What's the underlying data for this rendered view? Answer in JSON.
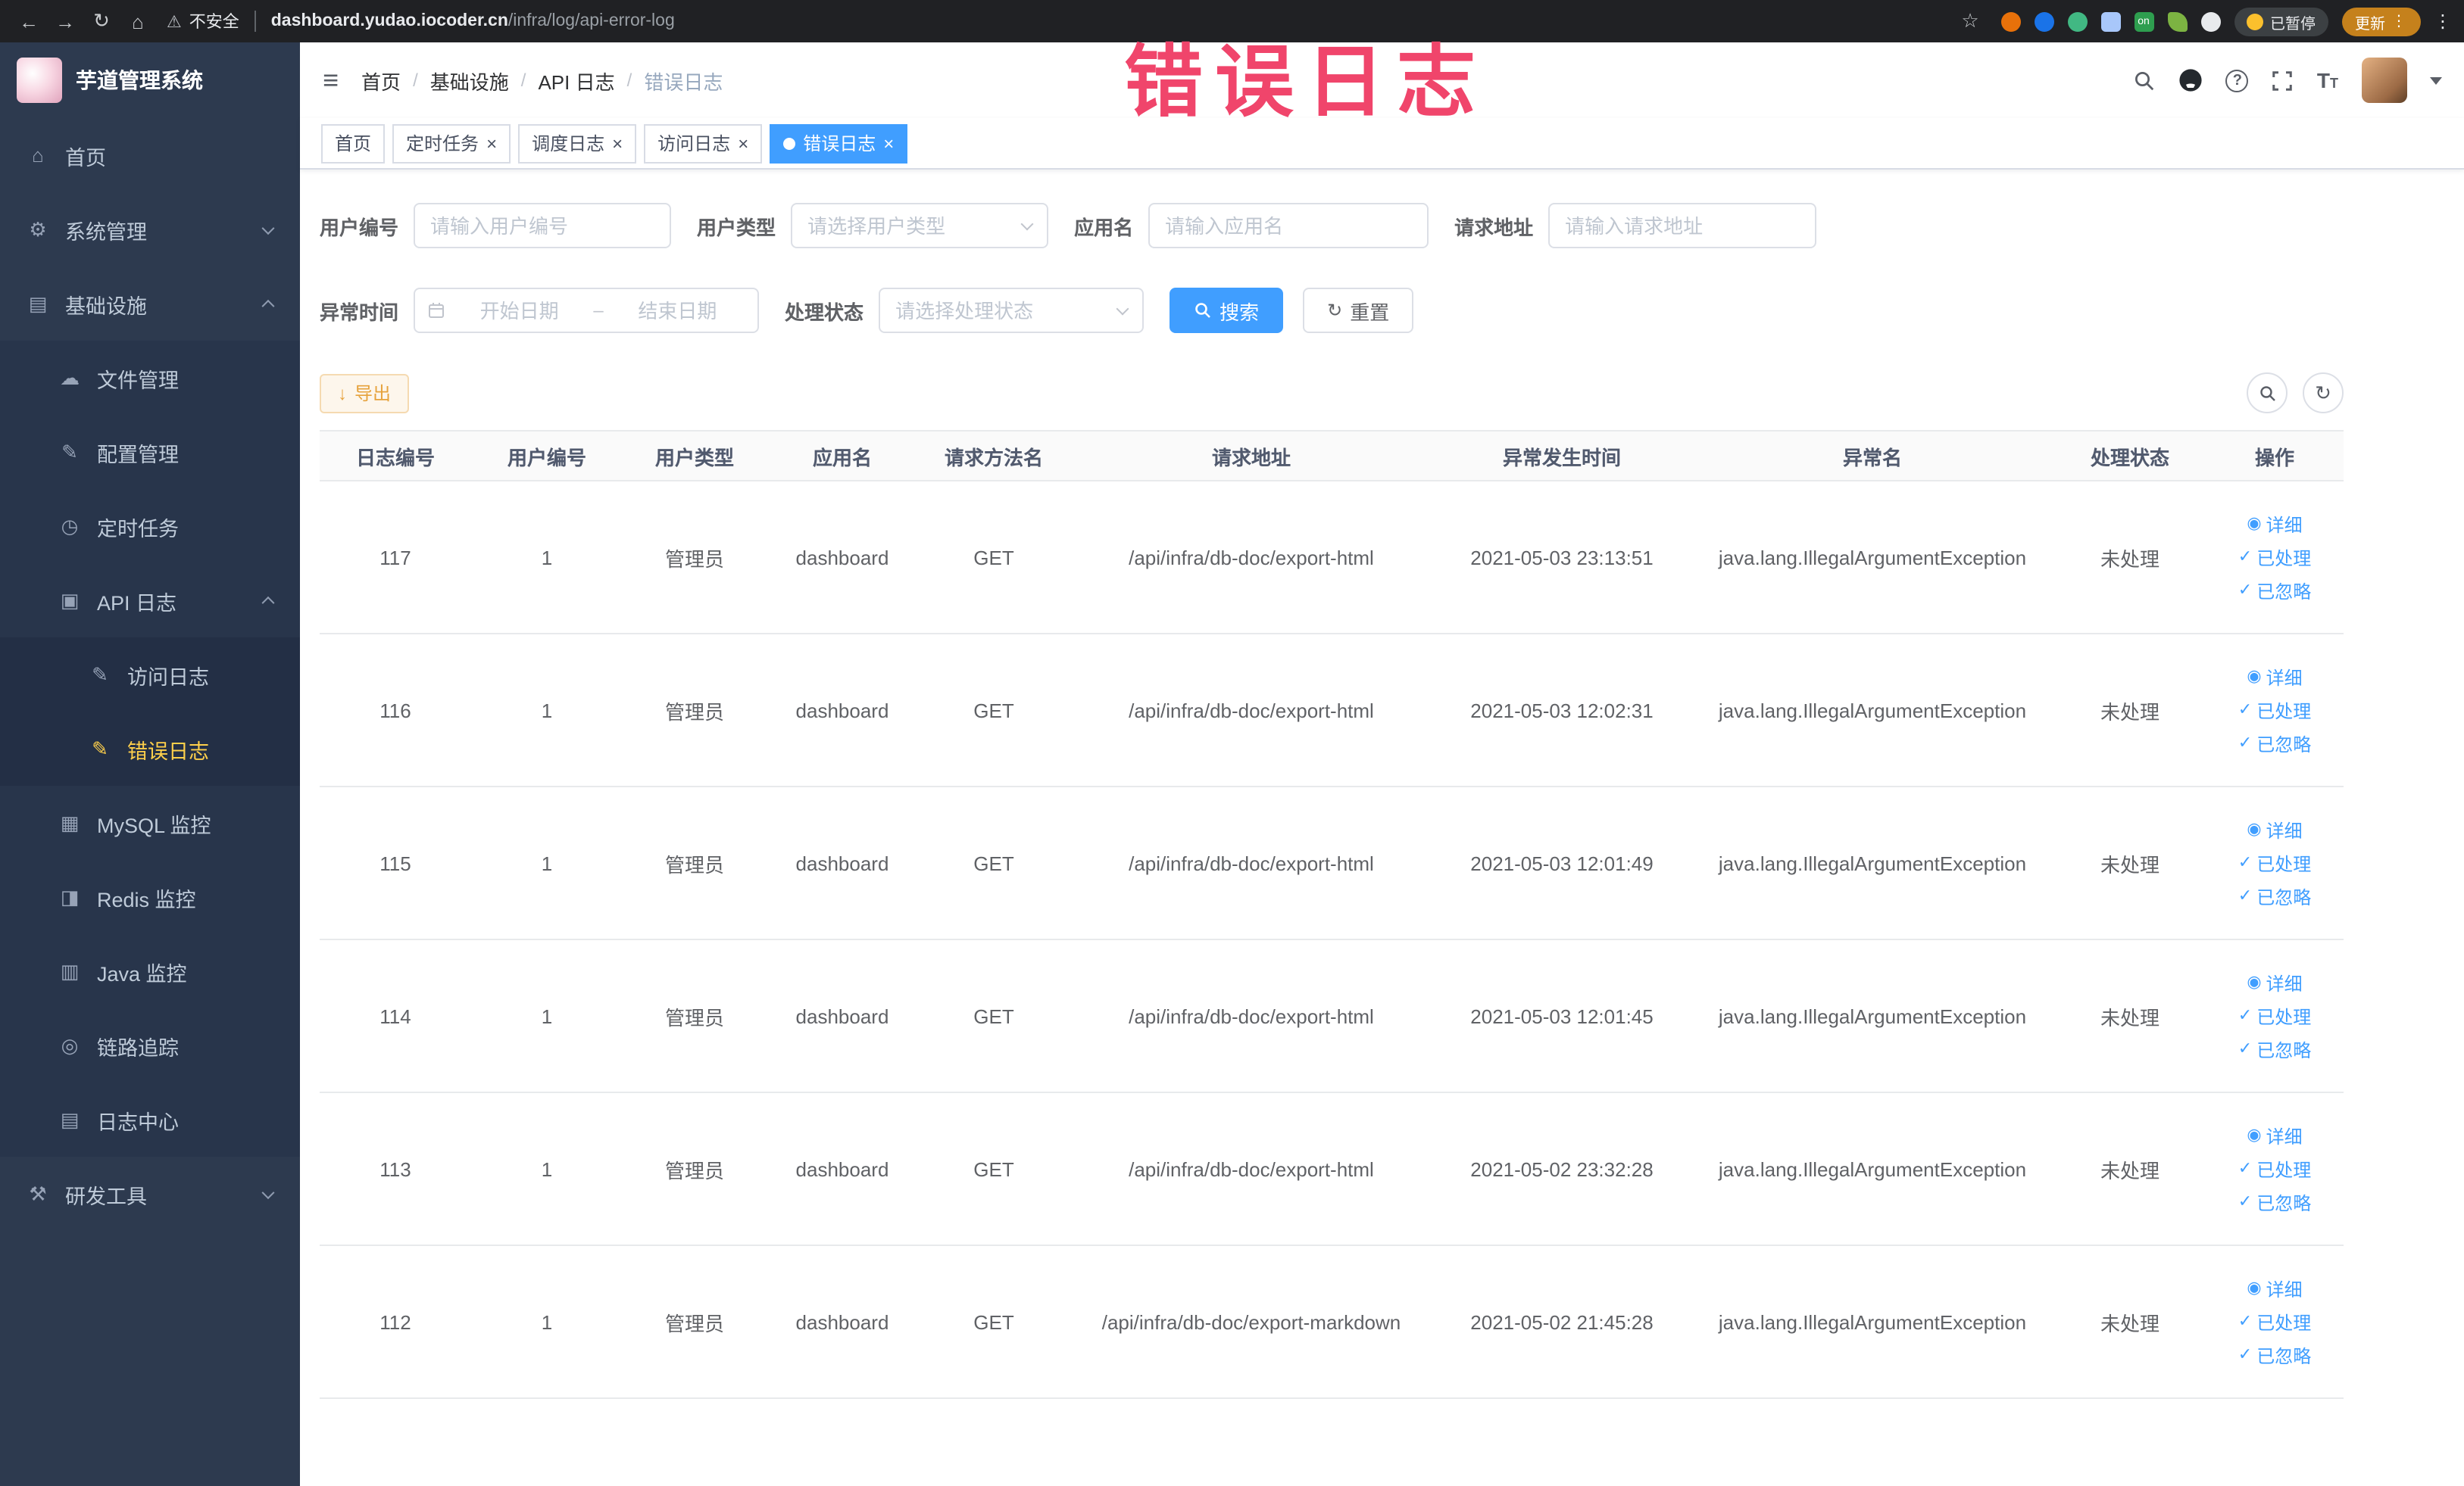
{
  "colors": {
    "primary_blue": "#409eff",
    "sidebar_background": "#2d3a4f",
    "sidebar_active_text": "#ffd04b",
    "annotation_pink": "#f0456b",
    "export_button_text": "#e6a23c",
    "update_button_background": "#c5811c"
  },
  "browser": {
    "security_warning": "不安全",
    "url_host": "dashboard.yudao.iocoder.cn",
    "url_path": "/infra/log/api-error-log",
    "extension_on_badge": "on",
    "paused_badge": "已暂停",
    "update_button": "更新"
  },
  "annotation": {
    "text": "错误日志"
  },
  "sidebar": {
    "logo_title": "芋道管理系统",
    "items": [
      {
        "label": "首页",
        "glyph": "⌂"
      },
      {
        "label": "系统管理",
        "glyph": "⚙"
      },
      {
        "label": "基础设施",
        "glyph": "▤"
      },
      {
        "label": "文件管理",
        "glyph": "☁"
      },
      {
        "label": "配置管理",
        "glyph": "✎"
      },
      {
        "label": "定时任务",
        "glyph": "◷"
      },
      {
        "label": "API 日志",
        "glyph": "▣"
      },
      {
        "label": "访问日志",
        "glyph": "✎"
      },
      {
        "label": "错误日志",
        "glyph": "✎"
      },
      {
        "label": "MySQL 监控",
        "glyph": "▦"
      },
      {
        "label": "Redis 监控",
        "glyph": "◨"
      },
      {
        "label": "Java 监控",
        "glyph": "▥"
      },
      {
        "label": "链路追踪",
        "glyph": "◎"
      },
      {
        "label": "日志中心",
        "glyph": "▤"
      },
      {
        "label": "研发工具",
        "glyph": "⚒"
      }
    ]
  },
  "header": {
    "breadcrumb": [
      "首页",
      "基础设施",
      "API 日志",
      "错误日志"
    ],
    "separator": "/"
  },
  "tabs": [
    {
      "label": "首页"
    },
    {
      "label": "定时任务"
    },
    {
      "label": "调度日志"
    },
    {
      "label": "访问日志"
    },
    {
      "label": "错误日志"
    }
  ],
  "filters": {
    "user_id": {
      "label": "用户编号",
      "placeholder": "请输入用户编号"
    },
    "user_type": {
      "label": "用户类型",
      "placeholder": "请选择用户类型"
    },
    "app_name": {
      "label": "应用名",
      "placeholder": "请输入应用名"
    },
    "request_url": {
      "label": "请求地址",
      "placeholder": "请输入请求地址"
    },
    "exception_time": {
      "label": "异常时间",
      "start_placeholder": "开始日期",
      "separator": "–",
      "end_placeholder": "结束日期"
    },
    "process_status": {
      "label": "处理状态",
      "placeholder": "请选择处理状态"
    },
    "search_button": "搜索",
    "reset_button": "重置"
  },
  "toolbar": {
    "export_button": "导出"
  },
  "table": {
    "columns": [
      "日志编号",
      "用户编号",
      "用户类型",
      "应用名",
      "请求方法名",
      "请求地址",
      "异常发生时间",
      "异常名",
      "处理状态",
      "操作"
    ],
    "actions": [
      "详细",
      "已处理",
      "已忽略"
    ],
    "rows": [
      {
        "log_id": "117",
        "user_id": "1",
        "user_type": "管理员",
        "app_name": "dashboard",
        "method": "GET",
        "url": "/api/infra/db-doc/export-html",
        "time": "2021-05-03 23:13:51",
        "exception": "java.lang.IllegalArgumentException",
        "status": "未处理"
      },
      {
        "log_id": "116",
        "user_id": "1",
        "user_type": "管理员",
        "app_name": "dashboard",
        "method": "GET",
        "url": "/api/infra/db-doc/export-html",
        "time": "2021-05-03 12:02:31",
        "exception": "java.lang.IllegalArgumentException",
        "status": "未处理"
      },
      {
        "log_id": "115",
        "user_id": "1",
        "user_type": "管理员",
        "app_name": "dashboard",
        "method": "GET",
        "url": "/api/infra/db-doc/export-html",
        "time": "2021-05-03 12:01:49",
        "exception": "java.lang.IllegalArgumentException",
        "status": "未处理"
      },
      {
        "log_id": "114",
        "user_id": "1",
        "user_type": "管理员",
        "app_name": "dashboard",
        "method": "GET",
        "url": "/api/infra/db-doc/export-html",
        "time": "2021-05-03 12:01:45",
        "exception": "java.lang.IllegalArgumentException",
        "status": "未处理"
      },
      {
        "log_id": "113",
        "user_id": "1",
        "user_type": "管理员",
        "app_name": "dashboard",
        "method": "GET",
        "url": "/api/infra/db-doc/export-html",
        "time": "2021-05-02 23:32:28",
        "exception": "java.lang.IllegalArgumentException",
        "status": "未处理"
      },
      {
        "log_id": "112",
        "user_id": "1",
        "user_type": "管理员",
        "app_name": "dashboard",
        "method": "GET",
        "url": "/api/infra/db-doc/export-markdown",
        "time": "2021-05-02 21:45:28",
        "exception": "java.lang.IllegalArgumentException",
        "status": "未处理"
      }
    ]
  },
  "icons": {
    "back": "←",
    "forward": "→",
    "reload": "↻",
    "home": "⌂",
    "warning": "⚠",
    "star": "☆",
    "kebab": "⋮",
    "hamburger": "≡",
    "close": "×",
    "check": "✓",
    "eye": "◉",
    "download": "↓",
    "refresh": "↻"
  }
}
